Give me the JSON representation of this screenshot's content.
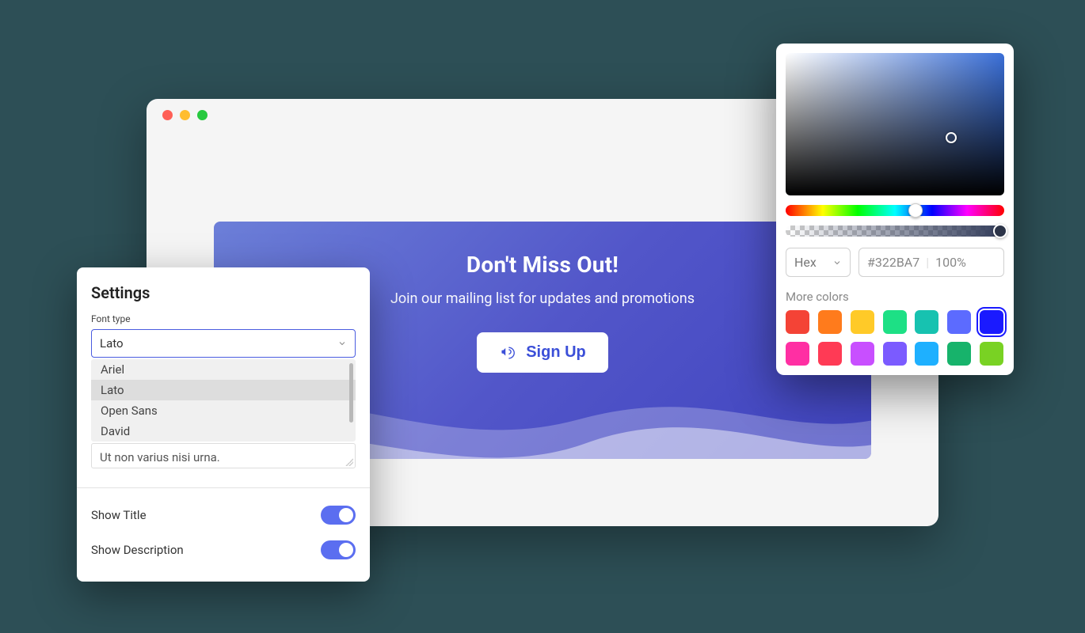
{
  "hero": {
    "title": "Don't Miss Out!",
    "subtitle": "Join our mailing list for updates and promotions",
    "button": "Sign Up"
  },
  "settings": {
    "heading": "Settings",
    "font_label": "Font type",
    "font_value": "Lato",
    "font_options": [
      "Ariel",
      "Lato",
      "Open Sans",
      "David"
    ],
    "font_selected_index": 1,
    "textarea_value": "Ut non varius nisi urna.",
    "toggles": [
      {
        "label": "Show Title",
        "on": true
      },
      {
        "label": "Show Description",
        "on": true
      }
    ]
  },
  "picker": {
    "format_label": "Hex",
    "hex": "#322BA7",
    "opacity": "100%",
    "more_label": "More colors",
    "swatches": [
      "#f44336",
      "#ff7b1c",
      "#ffca28",
      "#1de085",
      "#17c2b0",
      "#5c6bff",
      "#1a1aff",
      "#ff2fa3",
      "#ff3a55",
      "#c84fff",
      "#7b5bff",
      "#1eb0ff",
      "#17b36b",
      "#79d223"
    ],
    "selected_swatch_index": 6
  }
}
